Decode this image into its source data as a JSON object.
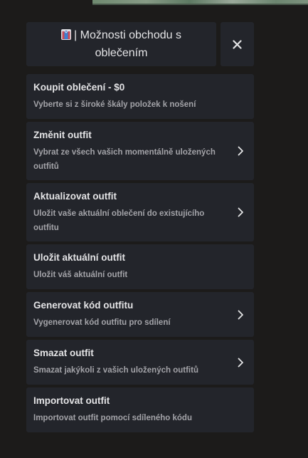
{
  "header": {
    "title": "| Možnosti obchodu s oblečením",
    "title_icon": "shirt-icon",
    "close_icon": "close-icon"
  },
  "colors": {
    "page_background": "#1c1b1a",
    "panel_background": "#23252b",
    "title_text": "#e4e4e6",
    "description_text": "#a3a3a8"
  },
  "items": [
    {
      "title": "Koupit oblečení - $0",
      "description": "Vyberte si z široké škály položek k nošení",
      "has_arrow": false
    },
    {
      "title": "Změnit outfit",
      "description": "Vybrat ze všech vašich momentálně uložených outfitů",
      "has_arrow": true
    },
    {
      "title": "Aktualizovat outfit",
      "description": "Uložit vaše aktuální oblečení do existujícího outfitu",
      "has_arrow": true
    },
    {
      "title": "Uložit aktuální outfit",
      "description": "Uložit váš aktuální outfit",
      "has_arrow": false
    },
    {
      "title": "Generovat kód outfitu",
      "description": "Vygenerovat kód outfitu pro sdílení",
      "has_arrow": true
    },
    {
      "title": "Smazat outfit",
      "description": "Smazat jakýkoli z vašich uložených outfitů",
      "has_arrow": true
    },
    {
      "title": "Importovat outfit",
      "description": "Importovat outfit pomocí sdíleného kódu",
      "has_arrow": false
    }
  ]
}
